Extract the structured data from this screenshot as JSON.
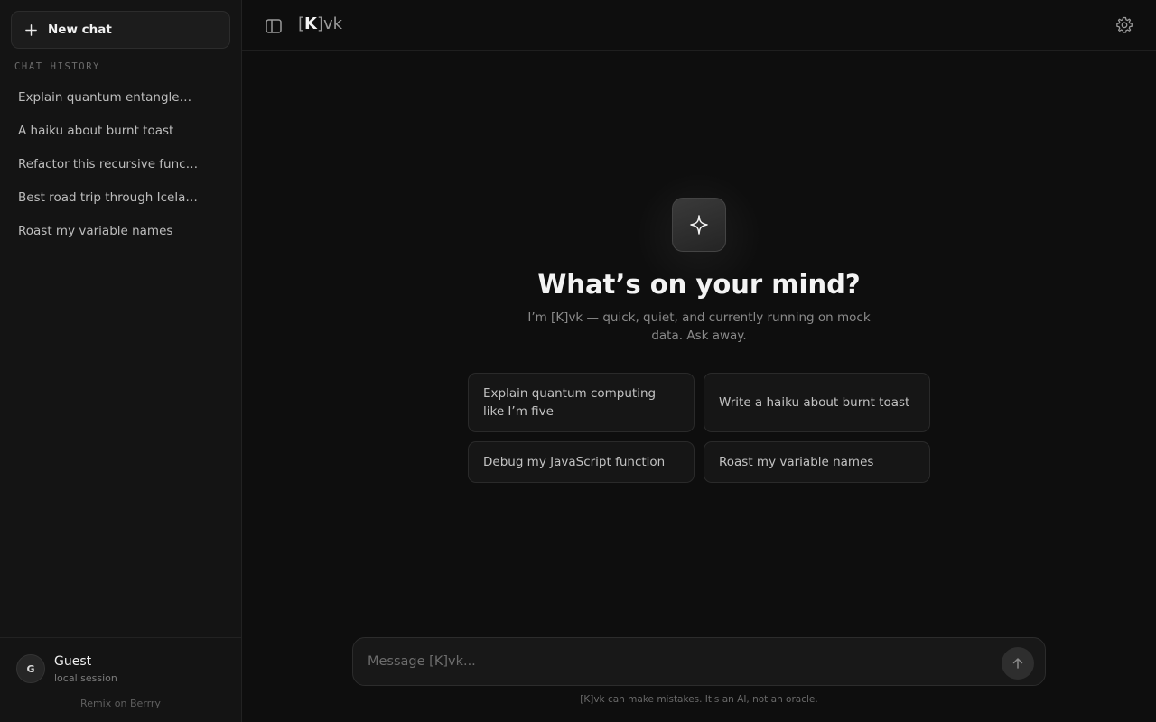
{
  "sidebar": {
    "new_chat_label": "New chat",
    "history_heading": "CHAT HISTORY",
    "history": [
      "Explain quantum entanglem…",
      "A haiku about burnt toast",
      "Refactor this recursive func…",
      "Best road trip through Icela…",
      "Roast my variable names"
    ],
    "user": {
      "initial": "G",
      "name": "Guest",
      "sub": "local session"
    },
    "remix_label": "Remix on Berrry"
  },
  "header": {
    "brand_open": "[",
    "brand_letter": "K",
    "brand_close": "]vk"
  },
  "hero": {
    "title": "What’s on your mind?",
    "subtitle": "I’m [K]vk — quick, quiet, and currently running on mock data. Ask away.",
    "suggestions": [
      "Explain quantum computing like I’m five",
      "Write a haiku about burnt toast",
      "Debug my JavaScript function",
      "Roast my variable names"
    ]
  },
  "composer": {
    "placeholder": "Message [K]vk...",
    "value": "",
    "disclaimer": "[K]vk can make mistakes. It's an AI, not an oracle."
  },
  "icons": {
    "new_chat": "plus-icon",
    "sidebar_toggle": "sidebar-panel-icon",
    "settings": "gear-icon",
    "logo": "sparkle-icon",
    "send": "arrow-up-icon"
  },
  "colors": {
    "background": "#0e0e0e",
    "sidebar": "#141414",
    "card": "#161616",
    "border": "#2a2a2a"
  }
}
